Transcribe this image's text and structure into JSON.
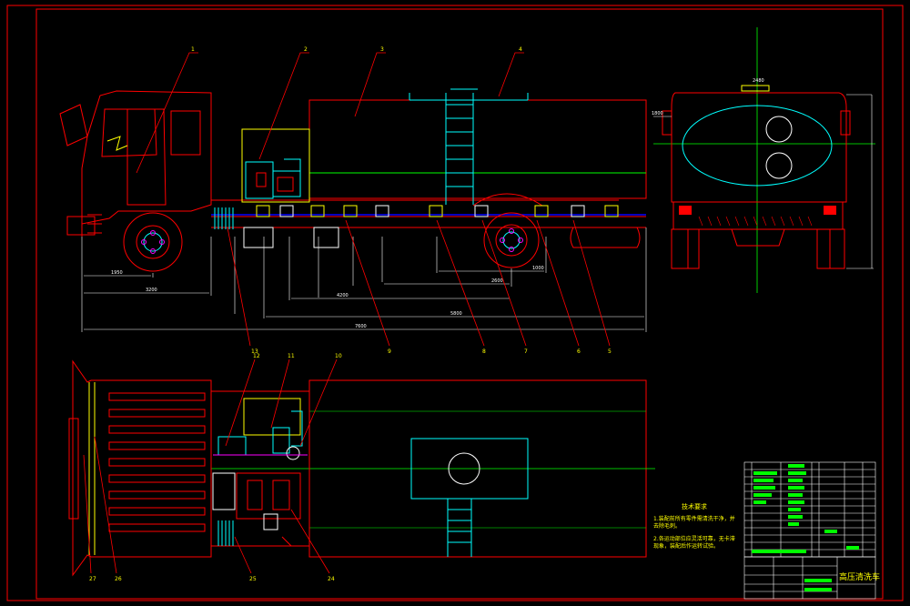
{
  "drawing": {
    "title_block_name": "高压清洗车",
    "tech_requirements": {
      "heading": "技术要求",
      "items": [
        "1.装配前所有零件需清洗干净，并去除毛刺。",
        "2.各运动部位应灵活可靠，无卡滞现象，装配后作运转试验。"
      ]
    },
    "side_view": {
      "top_callouts": [
        "1",
        "2",
        "3",
        "4"
      ],
      "bottom_callouts": [
        "13",
        "9",
        "8",
        "7",
        "6",
        "5"
      ],
      "dims": [
        "1950",
        "3200",
        "4200",
        "5800",
        "2600",
        "1000",
        "7600"
      ]
    },
    "rear_view": {
      "height_label": "1800",
      "width_label": "2480"
    },
    "top_view": {
      "callouts_top": [
        "12",
        "11",
        "10"
      ],
      "callouts_bottom": [
        "27",
        "26",
        "25",
        "24"
      ]
    }
  },
  "colors": {
    "background": "#000000",
    "outline": "#ff0000",
    "detail": "#00ffff",
    "hidden": "#00ff00",
    "text": "#ffff00",
    "dim": "#ffffff",
    "axle": "#0000ff",
    "mount": "#ffff00",
    "accent": "#ff00ff"
  }
}
